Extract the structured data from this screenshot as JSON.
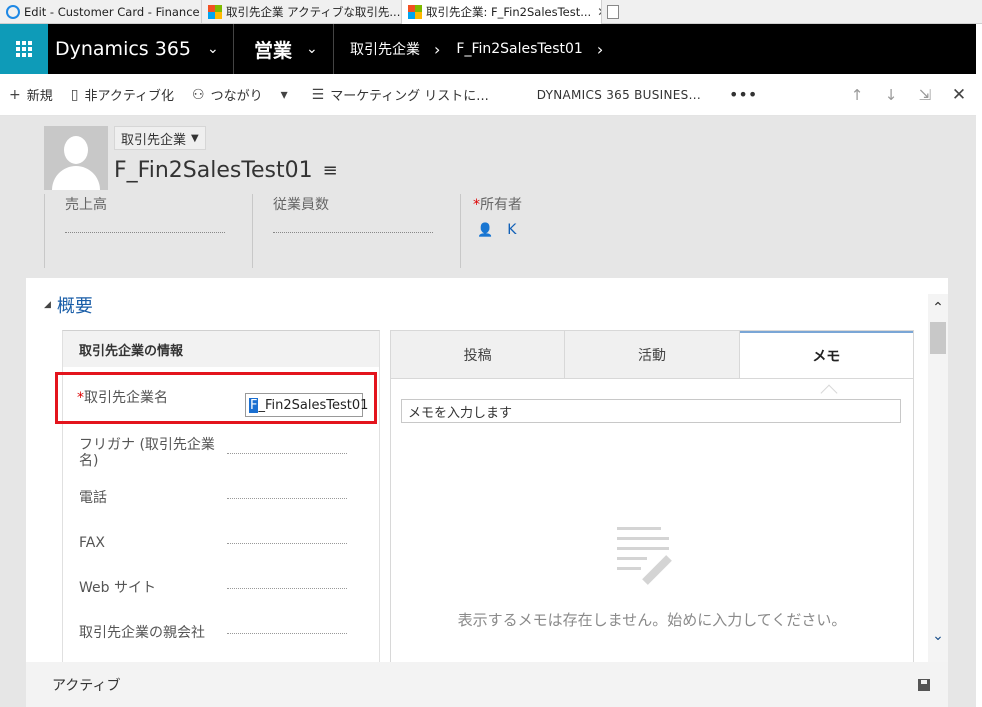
{
  "browser": {
    "tabs": [
      {
        "label": "Edit - Customer Card - Finance ...",
        "icon": "ie-icon",
        "active": false
      },
      {
        "label": "取引先企業 アクティブな取引先...",
        "icon": "ms-icon",
        "active": false
      },
      {
        "label": "取引先企業: F_Fin2SalesTest...",
        "icon": "ms-icon",
        "active": true
      }
    ],
    "close_glyph": "✕"
  },
  "nav": {
    "brand": "Dynamics 365",
    "module": "営業",
    "crumbs": [
      "取引先企業",
      "F_Fin2SalesTest01"
    ],
    "chevron": "⌄",
    "sep": "›"
  },
  "commands": {
    "new": "新規",
    "deactivate": "非アクティブ化",
    "connect": "つながり",
    "marketing_list": "マーケティング リストに...",
    "d365_business": "DYNAMICS 365 BUSINES...",
    "more": "•••"
  },
  "header": {
    "entity_type": "取引先企業",
    "record_name": "F_Fin2SalesTest01",
    "fields": {
      "revenue_label": "売上高",
      "employees_label": "従業員数",
      "owner_label": "所有者",
      "owner_value": "K"
    }
  },
  "form": {
    "section_title": "概要",
    "account_info_header": "取引先企業の情報",
    "fields": {
      "account_name_label": "取引先企業名",
      "account_name_value_first": "F",
      "account_name_value_rest": "_Fin2SalesTest01",
      "furigana_label": "フリガナ (取引先企業名)",
      "phone_label": "電話",
      "fax_label": "FAX",
      "website_label": "Web サイト",
      "parent_label": "取引先企業の親会社"
    },
    "tabs": [
      "投稿",
      "活動",
      "メモ"
    ],
    "memo_placeholder": "メモを入力します",
    "empty_notes": "表示するメモは存在しません。始めに入力してください。"
  },
  "footer": {
    "status": "アクティブ"
  },
  "colors": {
    "accent": "#0e9bb8",
    "highlight": "#e3141d",
    "link": "#1160b7"
  }
}
